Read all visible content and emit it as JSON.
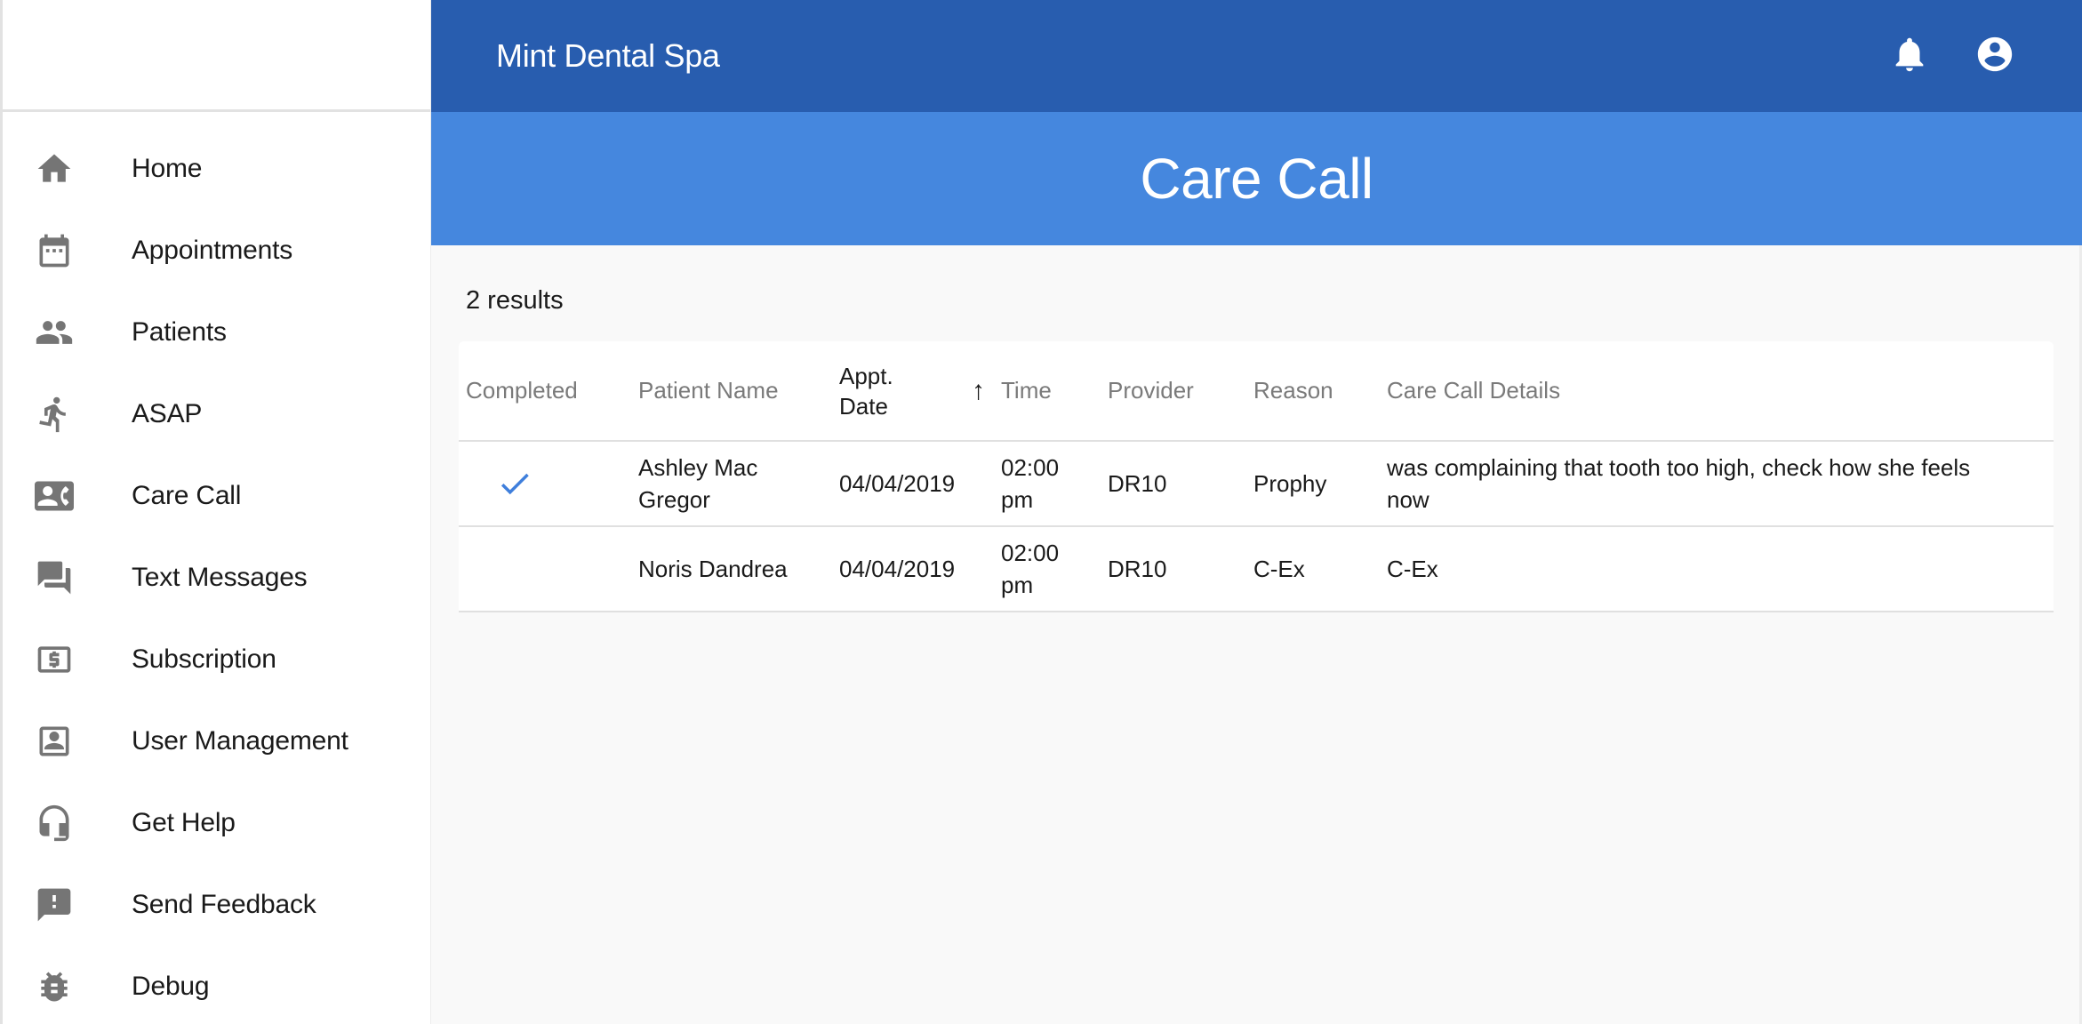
{
  "app": {
    "title": "Mint Dental Spa"
  },
  "header": {
    "notifications_icon": "bell-icon",
    "account_icon": "account-circle-icon"
  },
  "sidebar": {
    "items": [
      {
        "label": "Home",
        "icon": "home-icon"
      },
      {
        "label": "Appointments",
        "icon": "calendar-icon"
      },
      {
        "label": "Patients",
        "icon": "people-icon"
      },
      {
        "label": "ASAP",
        "icon": "running-person-icon"
      },
      {
        "label": "Care Call",
        "icon": "contact-phone-icon"
      },
      {
        "label": "Text Messages",
        "icon": "chat-bubbles-icon"
      },
      {
        "label": "Subscription",
        "icon": "dollar-card-icon"
      },
      {
        "label": "User Management",
        "icon": "user-badge-icon"
      },
      {
        "label": "Get Help",
        "icon": "headset-icon"
      },
      {
        "label": "Send Feedback",
        "icon": "feedback-icon"
      },
      {
        "label": "Debug",
        "icon": "bug-icon"
      }
    ]
  },
  "page": {
    "title": "Care Call",
    "results_label": "2 results"
  },
  "table": {
    "columns": {
      "completed": "Completed",
      "patient_name": "Patient Name",
      "appt_date": "Appt. Date",
      "time": "Time",
      "provider": "Provider",
      "reason": "Reason",
      "details": "Care Call Details"
    },
    "sort": {
      "column": "appt_date",
      "direction": "ascending",
      "icon": "arrow-up-icon",
      "glyph": "↑"
    },
    "rows": [
      {
        "completed": true,
        "patient_name": "Ashley Mac Gregor",
        "appt_date": "04/04/2019",
        "time": "02:00 pm",
        "provider": "DR10",
        "reason": "Prophy",
        "details": "was complaining that tooth too high, check how she feels now"
      },
      {
        "completed": false,
        "patient_name": "Noris Dandrea",
        "appt_date": "04/04/2019",
        "time": "02:00 pm",
        "provider": "DR10",
        "reason": "C-Ex",
        "details": "C-Ex"
      }
    ]
  },
  "colors": {
    "topbar": "#285daf",
    "banner": "#4587de",
    "check": "#3f7fdc",
    "icon_gray": "#757575",
    "background": "#f9f9f9"
  }
}
